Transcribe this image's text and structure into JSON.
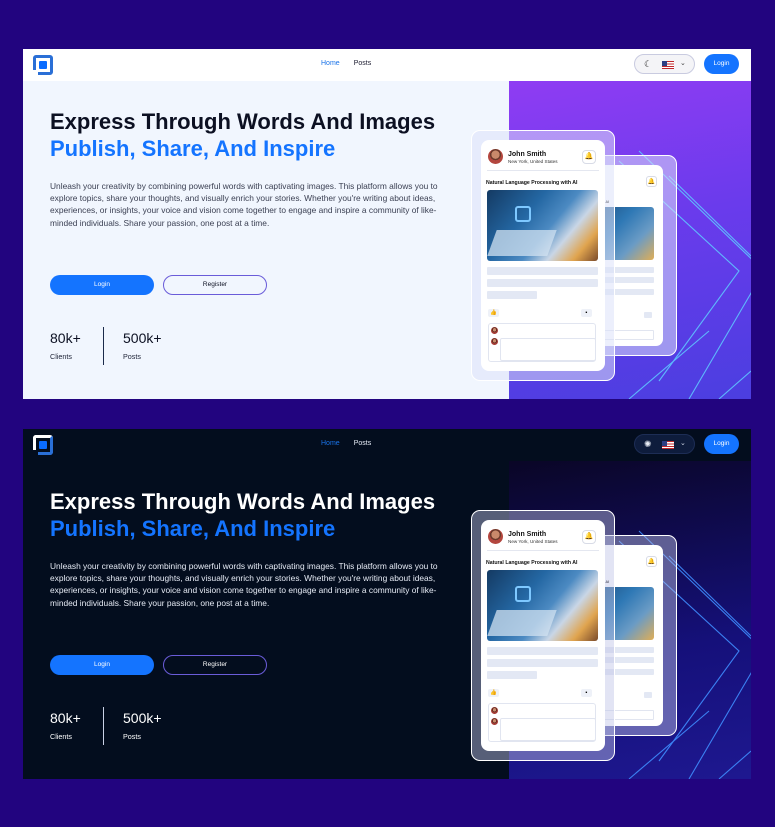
{
  "nav": {
    "links": [
      "Home",
      "Posts"
    ],
    "login": "Login",
    "theme_icon_light": "moon-icon",
    "theme_icon_dark": "sun-icon",
    "language_icon": "us-flag-icon"
  },
  "hero": {
    "title": "Express Through Words And Images",
    "subtitle": "Publish, Share, And Inspire",
    "description": "Unleash your creativity by combining powerful words with captivating images. This platform allows you to explore topics, share your thoughts, and visually enrich your stories. Whether you're writing about ideas, experiences, or insights, your voice and vision come together to engage and inspire a community of like-minded individuals. Share your passion, one post at a time.",
    "login_button": "Login",
    "register_button": "Register"
  },
  "stats": [
    {
      "value": "80k+",
      "label": "Clients"
    },
    {
      "value": "500k+",
      "label": "Posts"
    }
  ],
  "card": {
    "user_name": "John Smith",
    "user_location": "New York, United States",
    "post_title": "Natural Language Processing with AI",
    "back_title": "sing with AI"
  },
  "colors": {
    "page_background": "#22047f",
    "accent": "#1474ff",
    "light_background": "#f1f6fe",
    "dark_background": "#030d1e"
  }
}
